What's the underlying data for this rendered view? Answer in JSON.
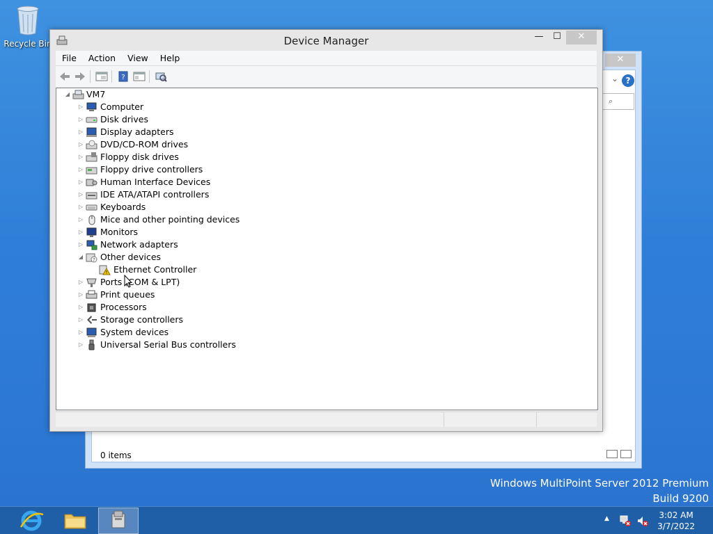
{
  "desktop": {
    "recycle_bin_label": "Recycle Bin",
    "watermark_line1": "Windows MultiPoint Server 2012 Premium",
    "watermark_line2": "Build 9200"
  },
  "back_window": {
    "close_glyph": "✕",
    "search_glyph": "⌕",
    "status_text": "0 items"
  },
  "device_manager": {
    "title": "Device Manager",
    "controls": {
      "minimize": "—",
      "maximize": "☐",
      "close": "✕"
    },
    "menus": [
      "File",
      "Action",
      "View",
      "Help"
    ],
    "tree": {
      "root": "VM7",
      "items": [
        {
          "label": "Computer",
          "icon": "computer-icon",
          "expanded": false
        },
        {
          "label": "Disk drives",
          "icon": "disk-drive-icon",
          "expanded": false
        },
        {
          "label": "Display adapters",
          "icon": "display-adapter-icon",
          "expanded": false
        },
        {
          "label": "DVD/CD-ROM drives",
          "icon": "dvd-drive-icon",
          "expanded": false
        },
        {
          "label": "Floppy disk drives",
          "icon": "floppy-disk-icon",
          "expanded": false
        },
        {
          "label": "Floppy drive controllers",
          "icon": "floppy-controller-icon",
          "expanded": false
        },
        {
          "label": "Human Interface Devices",
          "icon": "hid-icon",
          "expanded": false
        },
        {
          "label": "IDE ATA/ATAPI controllers",
          "icon": "ide-controller-icon",
          "expanded": false
        },
        {
          "label": "Keyboards",
          "icon": "keyboard-icon",
          "expanded": false
        },
        {
          "label": "Mice and other pointing devices",
          "icon": "mouse-icon",
          "expanded": false
        },
        {
          "label": "Monitors",
          "icon": "monitor-icon",
          "expanded": false
        },
        {
          "label": "Network adapters",
          "icon": "network-adapter-icon",
          "expanded": false
        },
        {
          "label": "Other devices",
          "icon": "unknown-device-icon",
          "expanded": true
        },
        {
          "label": "Ethernet Controller",
          "icon": "warning-device-icon",
          "child": true
        },
        {
          "label": "Ports (COM & LPT)",
          "icon": "port-icon",
          "expanded": false
        },
        {
          "label": "Print queues",
          "icon": "printer-icon",
          "expanded": false
        },
        {
          "label": "Processors",
          "icon": "processor-icon",
          "expanded": false
        },
        {
          "label": "Storage controllers",
          "icon": "storage-controller-icon",
          "expanded": false
        },
        {
          "label": "System devices",
          "icon": "system-device-icon",
          "expanded": false
        },
        {
          "label": "Universal Serial Bus controllers",
          "icon": "usb-icon",
          "expanded": false
        }
      ]
    }
  },
  "taskbar": {
    "time": "3:02 AM",
    "date": "3/7/2022",
    "tray_arrow": "▲"
  },
  "colors": {
    "desktop_blue": "#2f7fd8",
    "taskbar_blue": "#1f5fa8",
    "warning_yellow": "#f5c400"
  }
}
